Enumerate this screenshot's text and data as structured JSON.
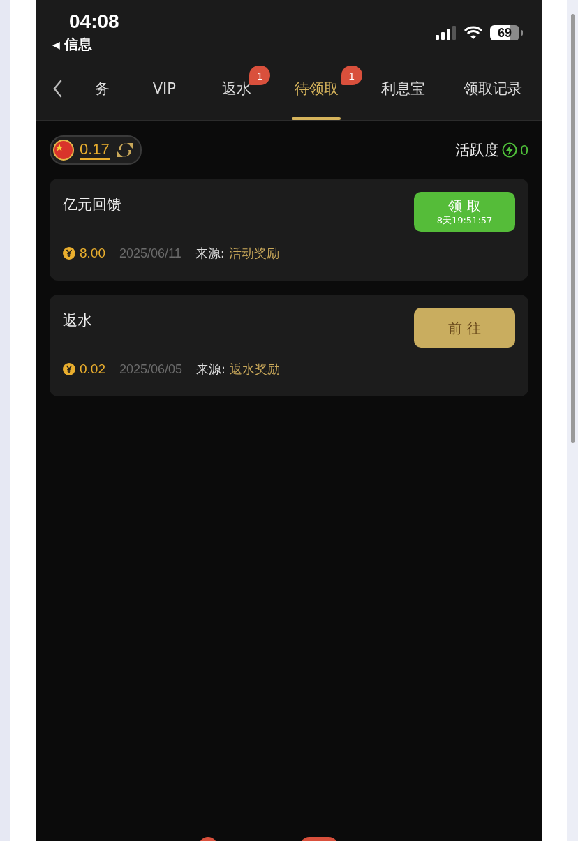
{
  "status_bar": {
    "time": "04:08",
    "back_arrow": "◀",
    "back_label": "信息",
    "battery": "69"
  },
  "tabs": [
    {
      "label": "务",
      "selected": false
    },
    {
      "label": "VIP",
      "selected": false
    },
    {
      "label": "返水",
      "selected": false,
      "badge": "1"
    },
    {
      "label": "待领取",
      "selected": true,
      "badge": "1"
    },
    {
      "label": "利息宝",
      "selected": false
    },
    {
      "label": "领取记录",
      "selected": false
    }
  ],
  "balance": {
    "amount": "0.17"
  },
  "activity": {
    "label": "活跃度",
    "value": "0"
  },
  "rewards": [
    {
      "title": "亿元回馈",
      "button": {
        "kind": "claim",
        "label": "领 取",
        "countdown": "8天19:51:57"
      },
      "amount": "8.00",
      "date": "2025/06/11",
      "source_label": "来源:",
      "source": "活动奖励"
    },
    {
      "title": "返水",
      "button": {
        "kind": "go",
        "label": "前 往"
      },
      "amount": "0.02",
      "date": "2025/06/05",
      "source_label": "来源:",
      "source": "返水奖励"
    }
  ]
}
